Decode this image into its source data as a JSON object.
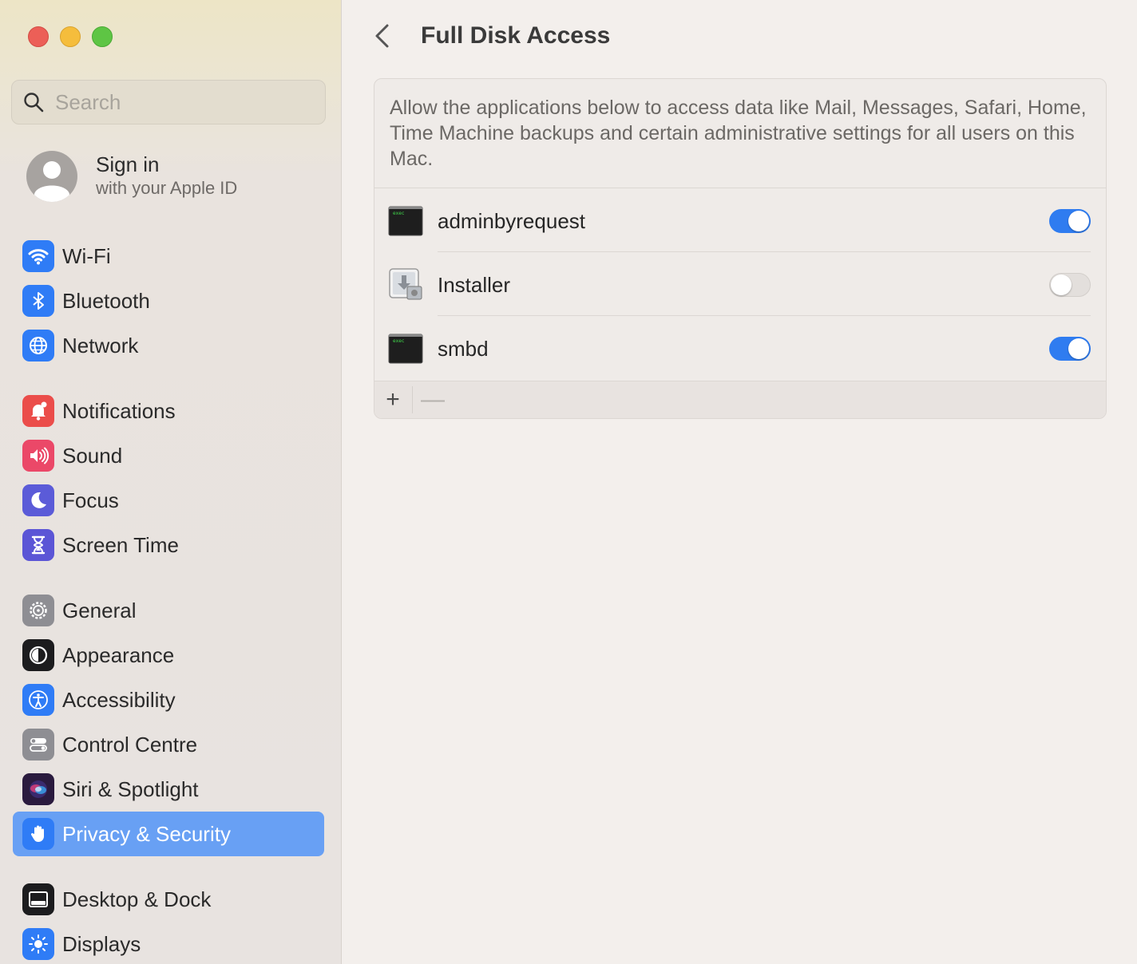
{
  "window": {
    "controls": [
      "close",
      "minimize",
      "maximize"
    ]
  },
  "search": {
    "placeholder": "Search"
  },
  "account": {
    "title": "Sign in",
    "subtitle": "with your Apple ID"
  },
  "sidebar": {
    "items": [
      {
        "label": "Wi-Fi",
        "icon": "wifi-icon",
        "color": "#2f7cf6"
      },
      {
        "label": "Bluetooth",
        "icon": "bluetooth-icon",
        "color": "#2f7cf6"
      },
      {
        "label": "Network",
        "icon": "globe-icon",
        "color": "#2f7cf6"
      },
      {
        "label": "Notifications",
        "icon": "bell-icon",
        "color": "#eb4d4a"
      },
      {
        "label": "Sound",
        "icon": "speaker-icon",
        "color": "#eb4868"
      },
      {
        "label": "Focus",
        "icon": "moon-icon",
        "color": "#5b5bd8"
      },
      {
        "label": "Screen Time",
        "icon": "hourglass-icon",
        "color": "#5b55d6"
      },
      {
        "label": "General",
        "icon": "gear-icon",
        "color": "#8e8e93"
      },
      {
        "label": "Appearance",
        "icon": "appearance-icon",
        "color": "#1c1c1e"
      },
      {
        "label": "Accessibility",
        "icon": "accessibility-icon",
        "color": "#2f7cf6"
      },
      {
        "label": "Control Centre",
        "icon": "control-centre-icon",
        "color": "#8e8e93"
      },
      {
        "label": "Siri & Spotlight",
        "icon": "siri-icon",
        "color": "#2a1a3e"
      },
      {
        "label": "Privacy & Security",
        "icon": "hand-icon",
        "color": "#2f7cf6",
        "selected": true
      },
      {
        "label": "Desktop & Dock",
        "icon": "dock-icon",
        "color": "#1c1c1e"
      },
      {
        "label": "Displays",
        "icon": "sun-icon",
        "color": "#2f7cf6"
      }
    ]
  },
  "main": {
    "title": "Full Disk Access",
    "description": "Allow the applications below to access data like Mail, Messages, Safari, Home, Time Machine backups and certain administrative settings for all users on this Mac.",
    "apps": [
      {
        "name": "adminbyrequest",
        "icon": "exec-terminal-icon",
        "icon_text": "exec",
        "enabled": true
      },
      {
        "name": "Installer",
        "icon": "installer-icon",
        "enabled": false
      },
      {
        "name": "smbd",
        "icon": "exec-terminal-icon",
        "icon_text": "exec",
        "enabled": true
      }
    ],
    "footer": {
      "add_label": "+",
      "remove_label": "—"
    }
  },
  "colors": {
    "accent": "#2f7cf0",
    "selection": "#68a0f4"
  }
}
